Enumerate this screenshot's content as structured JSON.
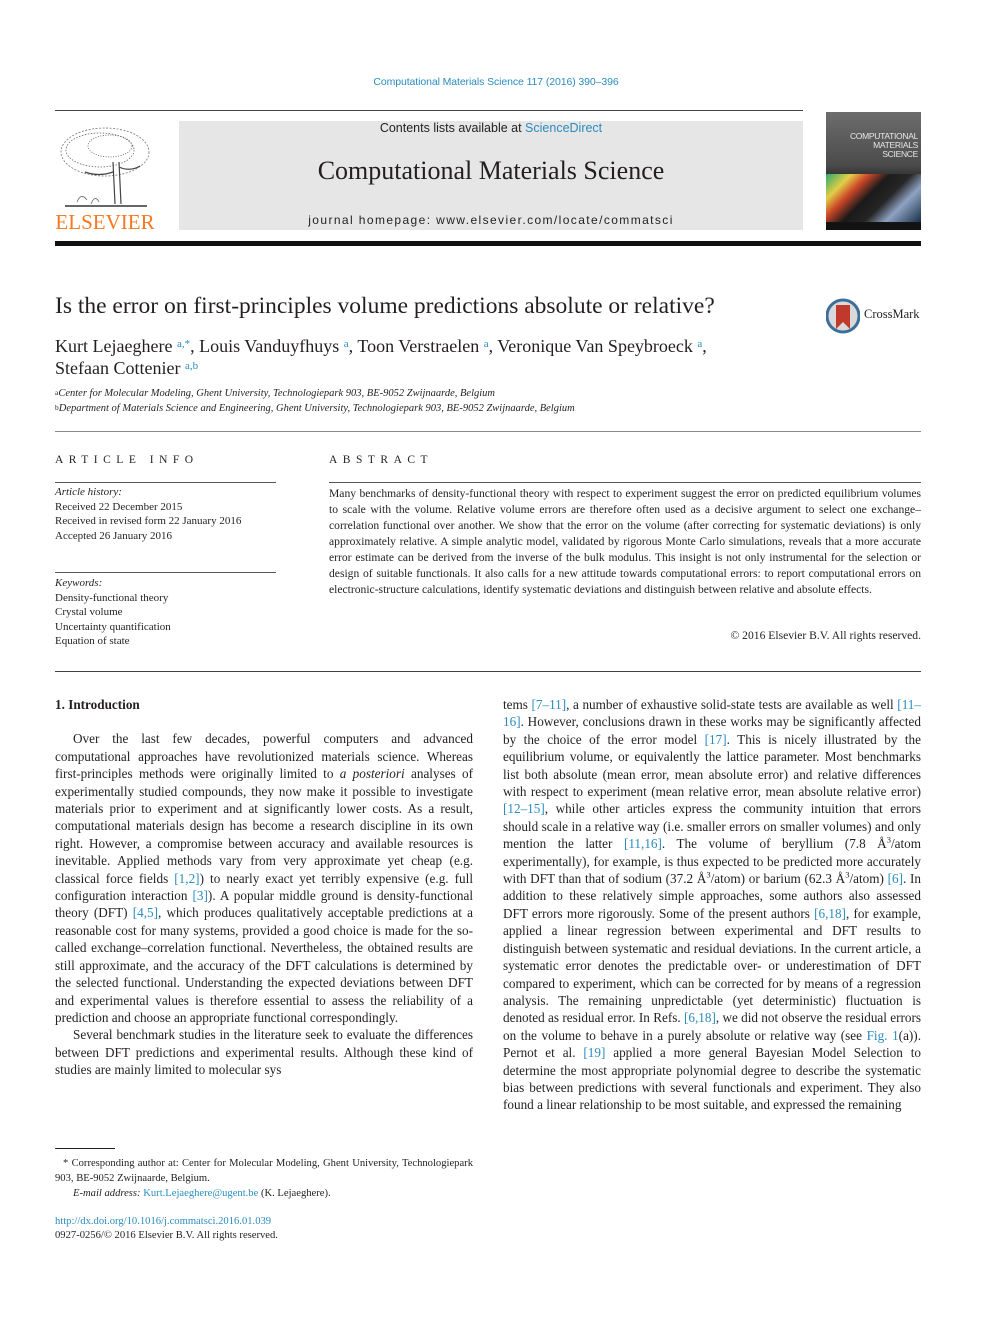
{
  "header": {
    "citation": "Computational Materials Science 117 (2016) 390–396",
    "contents_prefix": "Contents lists available at ",
    "contents_link": "ScienceDirect",
    "journal_name": "Computational Materials Science",
    "homepage": "journal homepage: www.elsevier.com/locate/commatsci",
    "publisher_logo_text": "ELSEVIER",
    "cover_title_lines": [
      "COMPUTATIONAL",
      "MATERIALS",
      "SCIENCE"
    ]
  },
  "article": {
    "title": "Is the error on first-principles volume predictions absolute or relative?",
    "crossmark_label": "CrossMark",
    "authors": [
      {
        "name": "Kurt Lejaeghere",
        "marks": "a,*",
        "sep": ", "
      },
      {
        "name": "Louis Vanduyfhuys",
        "marks": "a",
        "sep": ", "
      },
      {
        "name": "Toon Verstraelen",
        "marks": "a",
        "sep": ", "
      },
      {
        "name": "Veronique Van Speybroeck",
        "marks": "a",
        "sep": ","
      },
      {
        "name": "Stefaan Cottenier",
        "marks": "a,b",
        "sep": ""
      }
    ],
    "affiliations": [
      {
        "mark": "a",
        "text": "Center for Molecular Modeling, Ghent University, Technologiepark 903, BE-9052 Zwijnaarde, Belgium"
      },
      {
        "mark": "b",
        "text": "Department of Materials Science and Engineering, Ghent University, Technologiepark 903, BE-9052 Zwijnaarde, Belgium"
      }
    ]
  },
  "article_info": {
    "heading": "ARTICLE INFO",
    "history_label": "Article history:",
    "history": [
      "Received 22 December 2015",
      "Received in revised form 22 January 2016",
      "Accepted 26 January 2016"
    ],
    "keywords_label": "Keywords:",
    "keywords": [
      "Density-functional theory",
      "Crystal volume",
      "Uncertainty quantification",
      "Equation of state"
    ]
  },
  "abstract": {
    "heading": "ABSTRACT",
    "text": "Many benchmarks of density-functional theory with respect to experiment suggest the error on predicted equilibrium volumes to scale with the volume. Relative volume errors are therefore often used as a deci­sive argument to select one exchange–correlation functional over another. We show that the error on the volume (after correcting for systematic deviations) is only approximately relative. A simple analytic model, validated by rigorous Monte Carlo simulations, reveals that a more accurate error estimate can be derived from the inverse of the bulk modulus. This insight is not only instrumental for the selection or design of suitable functionals. It also calls for a new attitude towards computational errors: to report computational errors on electronic-structure calculations, identify systematic deviations and distinguish between relative and absolute effects.",
    "copyright": "© 2016 Elsevier B.V. All rights reserved."
  },
  "body": {
    "section_heading": "1. Introduction",
    "left_paragraphs": [
      [
        {
          "t": "Over the last few decades, powerful computers and advanced computational approaches have revolutionized materials science. Whereas first-principles methods were originally limited to "
        },
        {
          "t": "a posteriori",
          "style": "italic"
        },
        {
          "t": " analyses of experimentally studied compounds, they now make it possible to investigate materials prior to experiment and at significantly lower costs. As a result, computational materials design has become a research discipline in its own right. However, a compromise between accuracy and available resources is inevita­ble. Applied methods vary from very approximate yet cheap (e.g. classical force fields "
        },
        {
          "t": "[1,2]",
          "style": "ref"
        },
        {
          "t": ") to nearly exact yet terribly expensive (e.g. full configuration interaction "
        },
        {
          "t": "[3]",
          "style": "ref"
        },
        {
          "t": "). A popular middle ground is density-functional theory (DFT) "
        },
        {
          "t": "[4,5]",
          "style": "ref"
        },
        {
          "t": ", which produces qualita­tively acceptable predictions at a reasonable cost for many sys­tems, provided a good choice is made for the so-called exchange–correlation functional. Nevertheless, the obtained results are still approximate, and the accuracy of the DFT calcula­tions is determined by the selected functional. Understanding the expected deviations between DFT and experimental values is therefore essential to assess the reliability of a prediction and choose an appropriate functional correspondingly."
        }
      ],
      [
        {
          "t": "Several benchmark studies in the literature seek to evaluate the differences between DFT predictions and experimental results. Although these kind of studies are mainly limited to molecular sys­"
        }
      ]
    ],
    "right_paragraph": [
      {
        "t": "tems "
      },
      {
        "t": "[7–11]",
        "style": "ref"
      },
      {
        "t": ", a number of exhaustive solid-state tests are available as well "
      },
      {
        "t": "[11–16]",
        "style": "ref"
      },
      {
        "t": ". However, conclusions drawn in these works may be significantly affected by the choice of the error model "
      },
      {
        "t": "[17]",
        "style": "ref"
      },
      {
        "t": ". This is nicely illustrated by the equilibrium volume, or equivalently the lattice parameter. Most benchmarks list both absolute (mean error, mean absolute error) and relative differences with respect to experiment (mean relative error, mean absolute relative error) "
      },
      {
        "t": "[12–15]",
        "style": "ref"
      },
      {
        "t": ", while other articles express the community intuition that errors should scale in a relative way (i.e. smaller errors on smaller volumes) and only mention the latter "
      },
      {
        "t": "[11,16]",
        "style": "ref"
      },
      {
        "t": ". The volume of beryl­lium (7.8 Å"
      },
      {
        "t": "3",
        "style": "sup"
      },
      {
        "t": "/atom experimentally), for example, is thus expected to be predicted more accurately with DFT than that of sodium (37.2 Å"
      },
      {
        "t": "3",
        "style": "sup"
      },
      {
        "t": "/atom) or barium (62.3 Å"
      },
      {
        "t": "3",
        "style": "sup"
      },
      {
        "t": "/atom) "
      },
      {
        "t": "[6]",
        "style": "ref"
      },
      {
        "t": ". In addition to these relatively simple approaches, some authors also assessed DFT errors more rigorously. Some of the present authors "
      },
      {
        "t": "[6,18]",
        "style": "ref"
      },
      {
        "t": ", for example, applied a linear regression between experimental and DFT results to distinguish between systematic and residual devia­tions. In the current article, a systematic error denotes the pre­dictable over- or underestimation of DFT compared to experiment, which can be corrected for by means of a regression analysis. The remaining unpredictable (yet deterministic) fluctua­tion is denoted as residual error. In Refs. "
      },
      {
        "t": "[6,18]",
        "style": "ref"
      },
      {
        "t": ", we did not observe the residual errors on the volume to behave in a purely absolute or relative way (see "
      },
      {
        "t": "Fig. 1",
        "style": "ref"
      },
      {
        "t": "(a)). Pernot et al. "
      },
      {
        "t": "[19]",
        "style": "ref"
      },
      {
        "t": " applied a more general Bayesian Model Selection to determine the most appropriate poly­nomial degree to describe the systematic bias between predictions with several functionals and experiment. They also found a linear relationship to be most suitable, and expressed the remaining"
      }
    ]
  },
  "footnotes": {
    "corresponding": "* Corresponding author at: Center for Molecular Modeling, Ghent University, Technologiepark 903, BE-9052 Zwijnaarde, Belgium.",
    "email_label": "E-mail address: ",
    "email": "Kurt.Lejaeghere@ugent.be",
    "email_suffix": " (K. Lejaeghere).",
    "doi": "http://dx.doi.org/10.1016/j.commatsci.2016.01.039",
    "issn": "0927-0256/© 2016 Elsevier B.V. All rights reserved."
  },
  "colors": {
    "link": "#2a8cbe",
    "elsevier_orange": "#f47920",
    "banner_gray": "#e6e6e6",
    "crossmark_red": "#c0392b"
  }
}
